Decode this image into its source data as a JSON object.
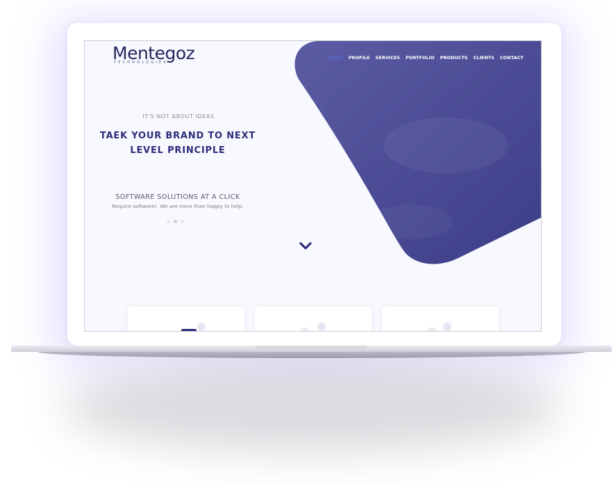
{
  "brand": {
    "name": "Mentegoz",
    "tagline": "TECHNOLOGIES"
  },
  "nav": {
    "items": [
      {
        "label": "HOME",
        "active": true
      },
      {
        "label": "PROFILE",
        "active": false
      },
      {
        "label": "SERVICES",
        "active": false
      },
      {
        "label": "PORTFOLIO",
        "active": false
      },
      {
        "label": "PRODUCTS",
        "active": false
      },
      {
        "label": "CLIENTS",
        "active": false
      },
      {
        "label": "CONTACT",
        "active": false
      }
    ]
  },
  "hero": {
    "eyebrow": "IT'S NOT ABOUT IDEAS",
    "headline_line1": "TAEK YOUR BRAND TO NEXT",
    "headline_line2": "LEVEL PRINCIPLE",
    "solution_title": "SOFTWARE SOLUTIONS AT A CLICK",
    "solution_subtitle": "Require software!. We are more than happy to help.",
    "slider_dots": 3,
    "active_slide": 2,
    "scroll_icon": "chevron-down-icon"
  },
  "colors": {
    "brand_navy": "#22265e",
    "accent": "#2a2d7a",
    "hero_shape": "#4a4b94",
    "nav_active": "#5a66cf"
  },
  "cards": {
    "count": 3,
    "icons": [
      "service-icon-1",
      "service-icon-2",
      "service-icon-3"
    ]
  }
}
